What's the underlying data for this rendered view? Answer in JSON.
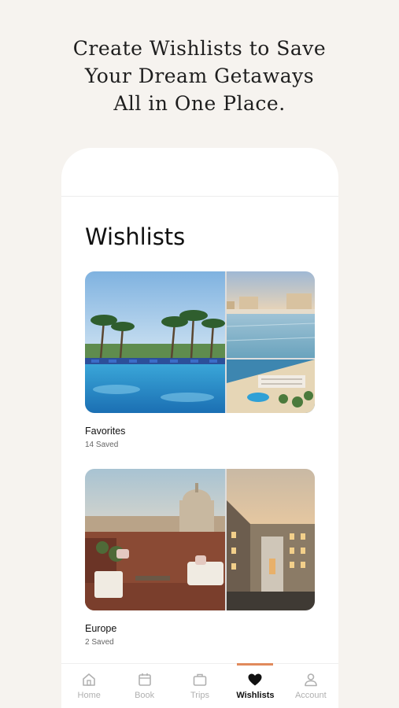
{
  "headline": {
    "line1": "Create Wishlists to Save",
    "line2": "Your Dream Getaways",
    "line3": "All in One Place."
  },
  "screen": {
    "title": "Wishlists",
    "wishlists": [
      {
        "name": "Favorites",
        "count": "14 Saved"
      },
      {
        "name": "Europe",
        "count": "2 Saved"
      }
    ]
  },
  "tabbar": {
    "items": [
      {
        "label": "Home",
        "icon": "home-icon"
      },
      {
        "label": "Book",
        "icon": "calendar-icon"
      },
      {
        "label": "Trips",
        "icon": "suitcase-icon"
      },
      {
        "label": "Wishlists",
        "icon": "heart-icon",
        "active": true
      },
      {
        "label": "Account",
        "icon": "person-icon"
      }
    ]
  },
  "colors": {
    "background": "#f6f3ef",
    "accent": "#e08a5c",
    "inactive": "#b0b0b0"
  }
}
